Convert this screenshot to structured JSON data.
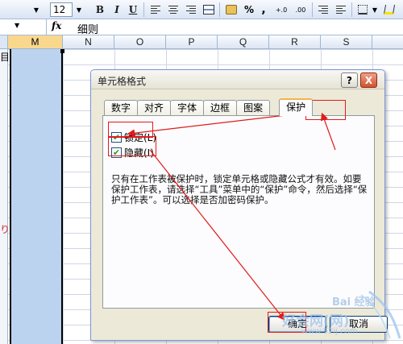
{
  "toolbar": {
    "font_size": "12",
    "bold_label": "B",
    "italic_label": "I",
    "underline_label": "U",
    "percent_label": "%",
    "comma_label": ",",
    "increase_decimal_label": "+.0",
    "decrease_decimal_label": ".00"
  },
  "formula_bar": {
    "fx_label": "fx",
    "value": "细则"
  },
  "sheet": {
    "columns": [
      "M",
      "N",
      "O",
      "P",
      "Q",
      "R",
      "S"
    ],
    "selected_column": "M",
    "stray_text_top": "目",
    "stray_text_mid": "り"
  },
  "dialog": {
    "title": "单元格格式",
    "help_label": "?",
    "close_label": "X",
    "tabs": [
      "数字",
      "对齐",
      "字体",
      "边框",
      "图案",
      "保护"
    ],
    "active_tab": "保护",
    "locked": {
      "label": "锁定(L)",
      "checked": true
    },
    "hidden": {
      "label": "隐藏(I)",
      "checked": true
    },
    "description": "只有在工作表被保护时，锁定单元格或隐藏公式才有效。如要保护工作表，请选择“工具”菜单中的“保护”命令，然后选择“保护工作表”。可以选择是否加密码保护。",
    "ok_label": "确定",
    "cancel_label": "取消"
  },
  "watermark": {
    "line1": "Bai 经验",
    "line2": "好会网(网)",
    "line3": "www.52ij.com"
  },
  "colors": {
    "annotation": "#e21a1a",
    "selected_column": "#bcd3f0",
    "dialog_face": "#ece9d8",
    "active_tab_accent": "#f3b54a"
  }
}
